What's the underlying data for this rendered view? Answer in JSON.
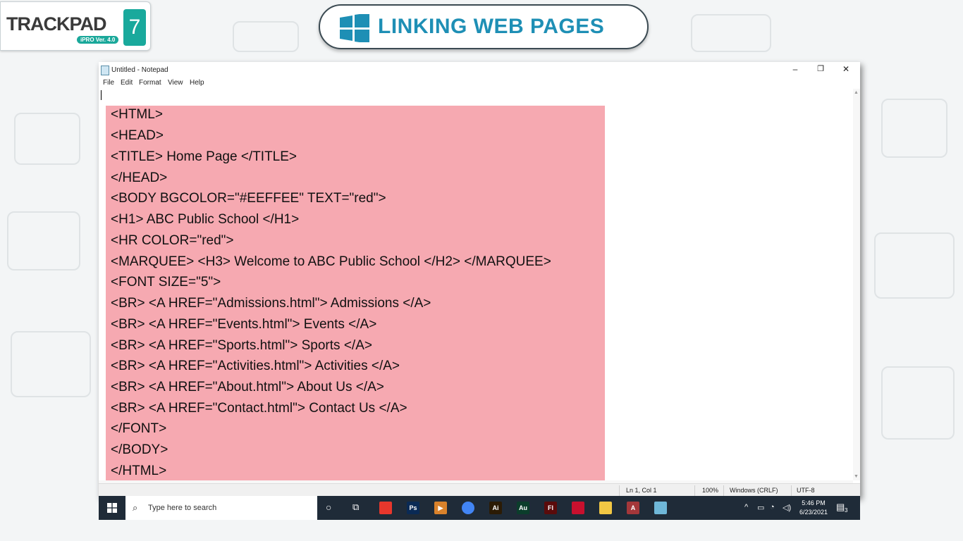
{
  "logo": {
    "brand": "TRACKPAD",
    "badge": "iPRO Ver. 4.0",
    "number": "7"
  },
  "header": {
    "title": "LINKING WEB PAGES"
  },
  "window": {
    "title": "Untitled - Notepad",
    "controls": {
      "minimize": "–",
      "restore": "❐",
      "close": "✕"
    }
  },
  "menu": {
    "file": "File",
    "edit": "Edit",
    "format": "Format",
    "view": "View",
    "help": "Help"
  },
  "code_lines": [
    "<HTML>",
    "<HEAD>",
    "<TITLE> Home Page </TITLE>",
    "</HEAD>",
    "<BODY BGCOLOR=\"#EEFFEE\" TEXT=\"red\">",
    "<H1> ABC Public School </H1>",
    "<HR COLOR=\"red\">",
    "<MARQUEE> <H3> Welcome to ABC Public School </H2> </MARQUEE>",
    "<FONT SIZE=\"5\">",
    "<BR> <A HREF=\"Admissions.html\"> Admissions </A>",
    "<BR> <A HREF=\"Events.html\"> Events </A>",
    "<BR> <A HREF=\"Sports.html\"> Sports </A>",
    "<BR> <A HREF=\"Activities.html\"> Activities </A>",
    "<BR> <A HREF=\"About.html\"> About Us </A>",
    "<BR> <A HREF=\"Contact.html\"> Contact Us </A>",
    "</FONT>",
    "</BODY>",
    "</HTML>"
  ],
  "status": {
    "position": "Ln 1, Col 1",
    "zoom": "100%",
    "line_ending": "Windows (CRLF)",
    "encoding": "UTF-8"
  },
  "taskbar": {
    "search_placeholder": "Type here to search",
    "time": "5:46 PM",
    "date": "6/23/2021",
    "notification_count": "3",
    "apps": [
      {
        "name": "anydesk-icon",
        "label": "",
        "color": "#e8372c"
      },
      {
        "name": "photoshop-icon",
        "label": "Ps",
        "color": "#0a2a55"
      },
      {
        "name": "media-player-icon",
        "label": "▶",
        "color": "#d9822b"
      },
      {
        "name": "chrome-icon",
        "label": "",
        "color": "#4285f4"
      },
      {
        "name": "illustrator-icon",
        "label": "Ai",
        "color": "#2b1b05"
      },
      {
        "name": "audition-icon",
        "label": "Au",
        "color": "#0b3d2b"
      },
      {
        "name": "flash-icon",
        "label": "Fl",
        "color": "#5a0b0b"
      },
      {
        "name": "acrobat-icon",
        "label": "",
        "color": "#c8102e"
      },
      {
        "name": "file-explorer-icon",
        "label": "",
        "color": "#f2c744"
      },
      {
        "name": "access-icon",
        "label": "A",
        "color": "#a4373a"
      },
      {
        "name": "notepad-taskbar-icon",
        "label": "",
        "color": "#6fb7d8"
      }
    ]
  }
}
